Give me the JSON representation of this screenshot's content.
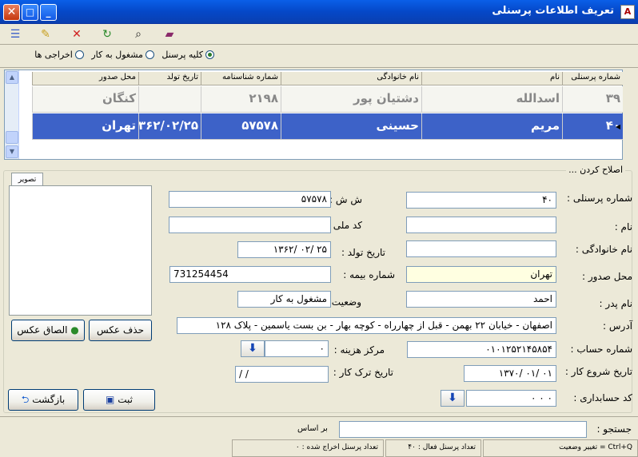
{
  "window": {
    "title": "تعریف اطلاعات پرسنلی"
  },
  "filters": {
    "all": "کلیه پرسنل",
    "active": "مشغول به کار",
    "fired": "اخراجی ها",
    "selected": "all"
  },
  "grid": {
    "columns": [
      "شماره پرسنلی",
      "نام",
      "نام خانوادگی",
      "شماره شناسنامه",
      "تاریخ تولد",
      "محل صدور"
    ],
    "rows": [
      {
        "id": "۳۹",
        "name": "اسدالله",
        "family": "دشتیان پور",
        "shenasnameh": "۲۱۹۸",
        "birth": "",
        "place": "کنگان"
      },
      {
        "id": "۴۰",
        "name": "مریم",
        "family": "حسینی",
        "shenasnameh": "۵۷۵۷۸",
        "birth": "۱۳۶۲/۰۲/۲۵",
        "place": "تهران"
      }
    ]
  },
  "form": {
    "group_title": "اصلاح کردن ...",
    "photo_tab": "تصویر",
    "labels": {
      "personnel_no": "شماره پرسنلی :",
      "name": "نام :",
      "family": "نام خانوادگی :",
      "place": "محل صدور :",
      "father": "نام پدر :",
      "address": "آدرس :",
      "account": "شماره حساب :",
      "start_date": "تاریخ شروع کار :",
      "accounting_code": "کد حسابداری :",
      "shsh": "ش ش :",
      "national_code": "کد ملی :",
      "birth_date": "تاریخ تولد :",
      "insurance": "شماره بیمه :",
      "status": "وضعیت :",
      "cost_center": "مرکز هزینه :",
      "leave_date": "تاریخ ترک کار :"
    },
    "values": {
      "personnel_no": "۴۰",
      "name": "",
      "family": "",
      "place": "تهران",
      "father": "احمد",
      "address": "اصفهان - خیابان ۲۲ بهمن - قبل از چهارراه - کوچه بهار - بن بست یاسمین - پلاک ۱۲۸",
      "account": "۰۱۰۱۲۵۲۱۴۵۸۵۴",
      "start_date": "۰۱ /۰۱ /۱۳۷۰",
      "accounting_code": "۰   ۰   ۰",
      "shsh": "۵۷۵۷۸",
      "national_code": "",
      "birth_date": "۲۵ /۰۲ /۱۳۶۲",
      "insurance": "731254454",
      "status": "مشغول به کار",
      "cost_center": "۰",
      "leave_date": "/      /"
    },
    "buttons": {
      "delete_photo": "حذف عکس",
      "attach_photo": "الصاق عکس",
      "save": "ثبت",
      "back": "بازگشت"
    }
  },
  "search": {
    "label": "جستجو :",
    "basis": "بر اساس",
    "value": ""
  },
  "status": {
    "hint": "Ctrl+Q = تغییر وضعیت",
    "active_count": "تعداد پرسنل فعال :  ۴۰",
    "fired_count": "تعداد پرسنل اخراج شده :  ۰"
  }
}
